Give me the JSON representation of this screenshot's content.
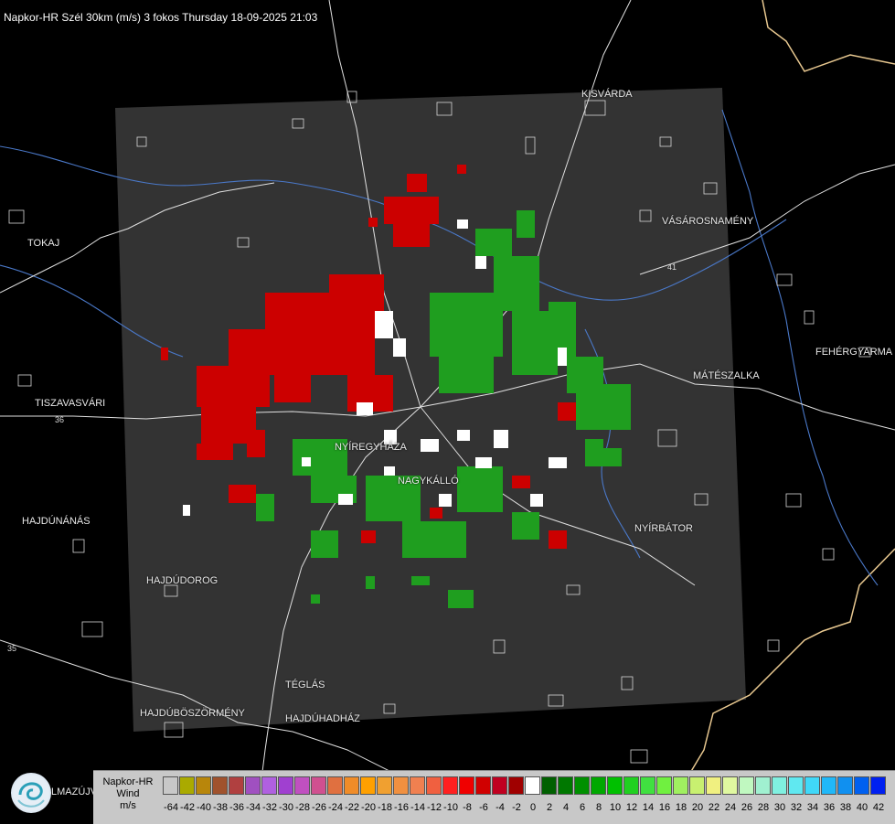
{
  "title": "Napkor-HR Szél 30km (m/s) 3 fokos Thursday 18-09-2025 21:03",
  "road_numbers": [
    "36",
    "35",
    "41"
  ],
  "towns": [
    {
      "id": "kisvarda",
      "label": "KISVÁRDA"
    },
    {
      "id": "tokaj",
      "label": "TOKAJ"
    },
    {
      "id": "vasarosnameny",
      "label": "VÁSÁROSNAMÉNY"
    },
    {
      "id": "fehergyarmat",
      "label": "FEHÉRGYARMA"
    },
    {
      "id": "mateszalka",
      "label": "MÁTÉSZALKA"
    },
    {
      "id": "tiszavasvari",
      "label": "TISZAVASVÁRI"
    },
    {
      "id": "nyiregyhaza",
      "label": "NYÍREGYHÁZA"
    },
    {
      "id": "nagykallo",
      "label": "NAGYKÁLLÓ"
    },
    {
      "id": "hajdunanas",
      "label": "HAJDÚNÁNÁS"
    },
    {
      "id": "nyirbator",
      "label": "NYÍRBÁTOR"
    },
    {
      "id": "hajdudorog",
      "label": "HAJDÚDOROG"
    },
    {
      "id": "teglas",
      "label": "TÉGLÁS"
    },
    {
      "id": "hajduboszormeny",
      "label": "HAJDÚBÖSZÖRMÉNY"
    },
    {
      "id": "hajduhadhaz",
      "label": "HAJDÚHADHÁZ"
    }
  ],
  "logo_text": "LMAZÚJVÁR",
  "legend": {
    "label_line1": "Napkor-HR",
    "label_line2": "Wind",
    "label_line3": "m/s",
    "ticks": [
      "-64",
      "-42",
      "-40",
      "-38",
      "-36",
      "-34",
      "-32",
      "-30",
      "-28",
      "-26",
      "-24",
      "-22",
      "-20",
      "-18",
      "-16",
      "-14",
      "-12",
      "-10",
      "-8",
      "-6",
      "-4",
      "-2",
      "0",
      "2",
      "4",
      "6",
      "8",
      "10",
      "12",
      "14",
      "16",
      "18",
      "20",
      "22",
      "24",
      "26",
      "28",
      "30",
      "32",
      "34",
      "36",
      "38",
      "40",
      "42"
    ],
    "colors": [
      "#c8c8c8",
      "#aaaa00",
      "#b8860b",
      "#a0522d",
      "#b04040",
      "#a050c0",
      "#b060e0",
      "#a040d0",
      "#c050c0",
      "#d05090",
      "#e07040",
      "#f08c28",
      "#ffa000",
      "#f0a030",
      "#f09040",
      "#f08050",
      "#f06040",
      "#ff2020",
      "#f00000",
      "#d00000",
      "#c00020",
      "#a00000",
      "#ffffff",
      "#006000",
      "#007800",
      "#009000",
      "#00a800",
      "#00c000",
      "#20d020",
      "#40e040",
      "#70f040",
      "#a0f060",
      "#c8f070",
      "#f0f080",
      "#e0f8a0",
      "#c0f8c0",
      "#a0f0d0",
      "#80f0e0",
      "#60e8f0",
      "#40d8f8",
      "#20b8f8",
      "#1090f0",
      "#0060f0",
      "#0020f0"
    ]
  }
}
